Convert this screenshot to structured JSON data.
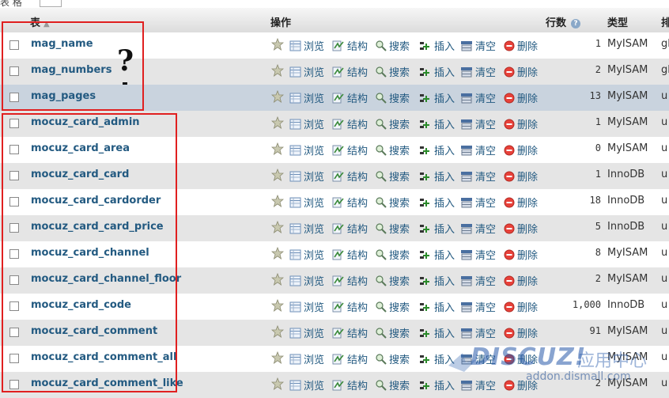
{
  "header": {
    "table_label": "表",
    "operations_label": "操作",
    "rows_label": "行数",
    "type_label": "类型",
    "collation_label": "排"
  },
  "actions": {
    "browse": "浏览",
    "structure": "结构",
    "search": "搜索",
    "insert": "插入",
    "empty": "清空",
    "drop": "删除"
  },
  "tables": [
    {
      "name": "mag_name",
      "rows": "1",
      "type": "MyISAM",
      "coll": "gl"
    },
    {
      "name": "mag_numbers",
      "rows": "2",
      "type": "MyISAM",
      "coll": "gl"
    },
    {
      "name": "mag_pages",
      "rows": "13",
      "type": "MyISAM",
      "coll": "u"
    },
    {
      "name": "mocuz_card_admin",
      "rows": "1",
      "type": "MyISAM",
      "coll": "u"
    },
    {
      "name": "mocuz_card_area",
      "rows": "0",
      "type": "MyISAM",
      "coll": "u"
    },
    {
      "name": "mocuz_card_card",
      "rows": "1",
      "type": "InnoDB",
      "coll": "u"
    },
    {
      "name": "mocuz_card_cardorder",
      "rows": "18",
      "type": "InnoDB",
      "coll": "u"
    },
    {
      "name": "mocuz_card_card_price",
      "rows": "5",
      "type": "InnoDB",
      "coll": "u"
    },
    {
      "name": "mocuz_card_channel",
      "rows": "8",
      "type": "MyISAM",
      "coll": "u"
    },
    {
      "name": "mocuz_card_channel_floor",
      "rows": "2",
      "type": "MyISAM",
      "coll": "u"
    },
    {
      "name": "mocuz_card_code",
      "rows": "1,000",
      "type": "InnoDB",
      "coll": "u"
    },
    {
      "name": "mocuz_card_comment",
      "rows": "91",
      "type": "MyISAM",
      "coll": "u"
    },
    {
      "name": "mocuz_card_comment_all",
      "rows": "",
      "type": "MyISAM",
      "coll": "u"
    },
    {
      "name": "mocuz_card_comment_like",
      "rows": "2",
      "type": "MyISAM",
      "coll": "u"
    }
  ],
  "annotation": {
    "mark": "?"
  },
  "watermark": {
    "brand": "DISCUZ!",
    "subtitle": "应用中心",
    "url": "addon.dismall.com"
  },
  "top_fragment": "表 格"
}
